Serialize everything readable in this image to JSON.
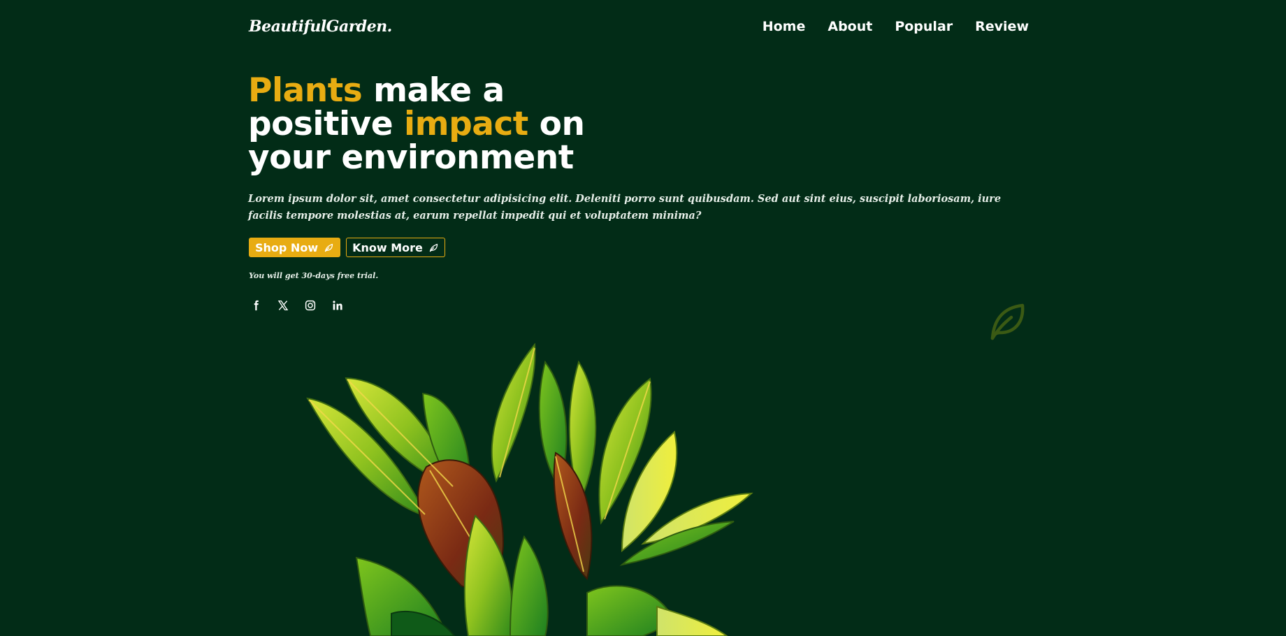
{
  "header": {
    "logo": "BeautifulGarden.",
    "nav": [
      "Home",
      "About",
      "Popular",
      "Review"
    ]
  },
  "hero": {
    "title_line1_accent": "Plants",
    "title_line1_rest": "make a",
    "title_line2_start": "positive",
    "title_line2_accent": "impact",
    "title_line2_end": "on",
    "title_line3": "your environment",
    "description": "Lorem ipsum dolor sit, amet consectetur adipisicing elit. Deleniti porro sunt quibusdam. Sed aut sint eius, suscipit laboriosam, iure facilis tempore molestias at, earum repellat impedit qui et voluptatem minima?",
    "primary_button": "Shop Now",
    "secondary_button": "Know More",
    "trial_note": "You will get 30-days free trial."
  },
  "socials": [
    "facebook-icon",
    "x-icon",
    "instagram-icon",
    "linkedin-icon"
  ],
  "colors": {
    "background": "#022c17",
    "accent": "#e8ac12",
    "text": "#ffffff",
    "decorative_leaf": "#3b5a14"
  }
}
